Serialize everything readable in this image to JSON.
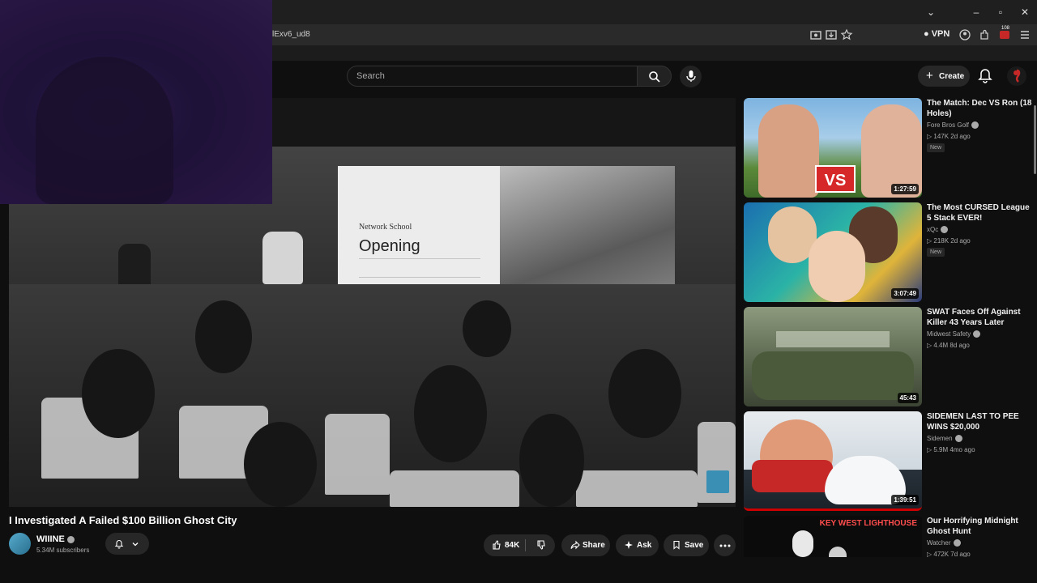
{
  "browser": {
    "url": "lExv6_ud8",
    "vpn_label": "VPN",
    "badge_count": "108"
  },
  "header": {
    "search_placeholder": "Search",
    "create_label": "Create"
  },
  "player": {
    "slide_brand": "Network School",
    "slide_title": "Opening"
  },
  "video": {
    "title": "I Investigated A Failed $100 Billion Ghost City",
    "channel": "WIIINE",
    "subscribers": "5.34M subscribers",
    "likes": "84K",
    "share_label": "Share",
    "ask_label": "Ask",
    "save_label": "Save"
  },
  "recommendations": [
    {
      "title": "The Match: Dec VS Ron (18 Holes)",
      "channel": "Fore Bros Golf",
      "stats": "▷ 147K  2d ago",
      "badge": "New",
      "duration": "1:27:59"
    },
    {
      "title": "The Most CURSED League 5 Stack EVER!",
      "channel": "xQc",
      "stats": "▷ 218K  2d ago",
      "badge": "New",
      "duration": "3:07:49"
    },
    {
      "title": "SWAT Faces Off Against Killer 43 Years Later",
      "channel": "Midwest Safety",
      "stats": "▷ 4.4M  8d ago",
      "badge": "",
      "duration": "45:43"
    },
    {
      "title": "SIDEMEN LAST TO PEE WINS $20,000",
      "channel": "Sidemen",
      "stats": "▷ 5.9M  4mo ago",
      "badge": "",
      "duration": "1:39:51"
    },
    {
      "title": "Our Horrifying Midnight Ghost Hunt",
      "channel": "Watcher",
      "stats": "▷ 472K  7d ago",
      "badge": "",
      "duration": ""
    }
  ],
  "thumb_texts": {
    "vs": "VS",
    "lighthouse": "KEY WEST LIGHTHOUSE"
  },
  "colors": {
    "accent_red": "#cc0000",
    "background": "#0f0f0f"
  }
}
